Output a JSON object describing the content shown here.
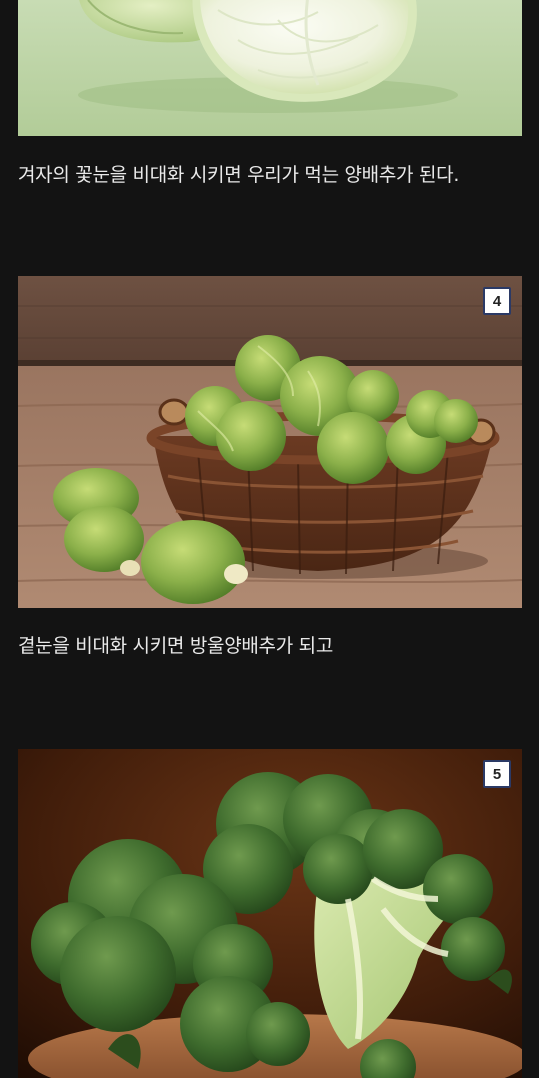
{
  "items": [
    {
      "image_subject": "cabbage",
      "caption": "겨자의 꽃눈을 비대화 시키면 우리가 먹는 양배추가 된다."
    },
    {
      "image_subject": "brussels-sprouts-basket",
      "badge": "4",
      "caption": "곁눈을 비대화 시키면 방울양배추가 되고"
    },
    {
      "image_subject": "broccoli",
      "badge": "5"
    }
  ],
  "colors": {
    "page_background": "#131313",
    "caption_text": "#e9e9e9",
    "badge_border": "#2b3a66"
  }
}
